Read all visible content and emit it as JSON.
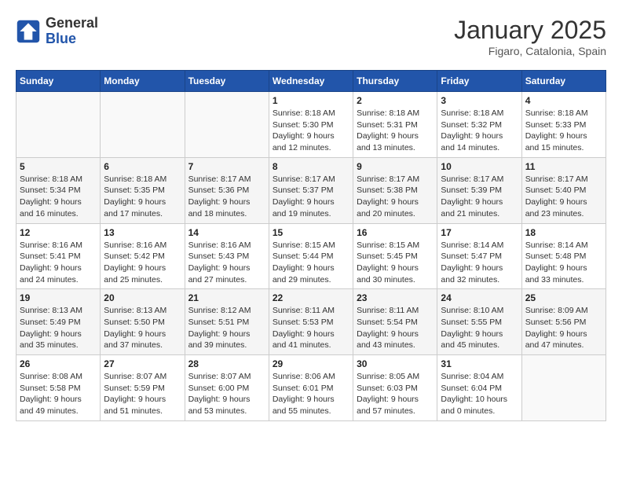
{
  "logo": {
    "general": "General",
    "blue": "Blue"
  },
  "header": {
    "month": "January 2025",
    "location": "Figaro, Catalonia, Spain"
  },
  "weekdays": [
    "Sunday",
    "Monday",
    "Tuesday",
    "Wednesday",
    "Thursday",
    "Friday",
    "Saturday"
  ],
  "weeks": [
    [
      {
        "day": "",
        "info": ""
      },
      {
        "day": "",
        "info": ""
      },
      {
        "day": "",
        "info": ""
      },
      {
        "day": "1",
        "info": "Sunrise: 8:18 AM\nSunset: 5:30 PM\nDaylight: 9 hours and 12 minutes."
      },
      {
        "day": "2",
        "info": "Sunrise: 8:18 AM\nSunset: 5:31 PM\nDaylight: 9 hours and 13 minutes."
      },
      {
        "day": "3",
        "info": "Sunrise: 8:18 AM\nSunset: 5:32 PM\nDaylight: 9 hours and 14 minutes."
      },
      {
        "day": "4",
        "info": "Sunrise: 8:18 AM\nSunset: 5:33 PM\nDaylight: 9 hours and 15 minutes."
      }
    ],
    [
      {
        "day": "5",
        "info": "Sunrise: 8:18 AM\nSunset: 5:34 PM\nDaylight: 9 hours and 16 minutes."
      },
      {
        "day": "6",
        "info": "Sunrise: 8:18 AM\nSunset: 5:35 PM\nDaylight: 9 hours and 17 minutes."
      },
      {
        "day": "7",
        "info": "Sunrise: 8:17 AM\nSunset: 5:36 PM\nDaylight: 9 hours and 18 minutes."
      },
      {
        "day": "8",
        "info": "Sunrise: 8:17 AM\nSunset: 5:37 PM\nDaylight: 9 hours and 19 minutes."
      },
      {
        "day": "9",
        "info": "Sunrise: 8:17 AM\nSunset: 5:38 PM\nDaylight: 9 hours and 20 minutes."
      },
      {
        "day": "10",
        "info": "Sunrise: 8:17 AM\nSunset: 5:39 PM\nDaylight: 9 hours and 21 minutes."
      },
      {
        "day": "11",
        "info": "Sunrise: 8:17 AM\nSunset: 5:40 PM\nDaylight: 9 hours and 23 minutes."
      }
    ],
    [
      {
        "day": "12",
        "info": "Sunrise: 8:16 AM\nSunset: 5:41 PM\nDaylight: 9 hours and 24 minutes."
      },
      {
        "day": "13",
        "info": "Sunrise: 8:16 AM\nSunset: 5:42 PM\nDaylight: 9 hours and 25 minutes."
      },
      {
        "day": "14",
        "info": "Sunrise: 8:16 AM\nSunset: 5:43 PM\nDaylight: 9 hours and 27 minutes."
      },
      {
        "day": "15",
        "info": "Sunrise: 8:15 AM\nSunset: 5:44 PM\nDaylight: 9 hours and 29 minutes."
      },
      {
        "day": "16",
        "info": "Sunrise: 8:15 AM\nSunset: 5:45 PM\nDaylight: 9 hours and 30 minutes."
      },
      {
        "day": "17",
        "info": "Sunrise: 8:14 AM\nSunset: 5:47 PM\nDaylight: 9 hours and 32 minutes."
      },
      {
        "day": "18",
        "info": "Sunrise: 8:14 AM\nSunset: 5:48 PM\nDaylight: 9 hours and 33 minutes."
      }
    ],
    [
      {
        "day": "19",
        "info": "Sunrise: 8:13 AM\nSunset: 5:49 PM\nDaylight: 9 hours and 35 minutes."
      },
      {
        "day": "20",
        "info": "Sunrise: 8:13 AM\nSunset: 5:50 PM\nDaylight: 9 hours and 37 minutes."
      },
      {
        "day": "21",
        "info": "Sunrise: 8:12 AM\nSunset: 5:51 PM\nDaylight: 9 hours and 39 minutes."
      },
      {
        "day": "22",
        "info": "Sunrise: 8:11 AM\nSunset: 5:53 PM\nDaylight: 9 hours and 41 minutes."
      },
      {
        "day": "23",
        "info": "Sunrise: 8:11 AM\nSunset: 5:54 PM\nDaylight: 9 hours and 43 minutes."
      },
      {
        "day": "24",
        "info": "Sunrise: 8:10 AM\nSunset: 5:55 PM\nDaylight: 9 hours and 45 minutes."
      },
      {
        "day": "25",
        "info": "Sunrise: 8:09 AM\nSunset: 5:56 PM\nDaylight: 9 hours and 47 minutes."
      }
    ],
    [
      {
        "day": "26",
        "info": "Sunrise: 8:08 AM\nSunset: 5:58 PM\nDaylight: 9 hours and 49 minutes."
      },
      {
        "day": "27",
        "info": "Sunrise: 8:07 AM\nSunset: 5:59 PM\nDaylight: 9 hours and 51 minutes."
      },
      {
        "day": "28",
        "info": "Sunrise: 8:07 AM\nSunset: 6:00 PM\nDaylight: 9 hours and 53 minutes."
      },
      {
        "day": "29",
        "info": "Sunrise: 8:06 AM\nSunset: 6:01 PM\nDaylight: 9 hours and 55 minutes."
      },
      {
        "day": "30",
        "info": "Sunrise: 8:05 AM\nSunset: 6:03 PM\nDaylight: 9 hours and 57 minutes."
      },
      {
        "day": "31",
        "info": "Sunrise: 8:04 AM\nSunset: 6:04 PM\nDaylight: 10 hours and 0 minutes."
      },
      {
        "day": "",
        "info": ""
      }
    ]
  ]
}
